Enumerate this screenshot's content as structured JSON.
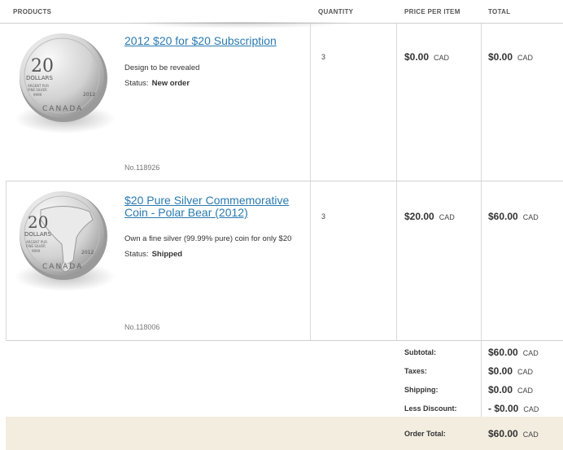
{
  "columns": {
    "products": "PRODUCTS",
    "quantity": "QUANTITY",
    "price": "PRICE PER ITEM",
    "total": "TOTAL"
  },
  "items": [
    {
      "title": "2012 $20 for $20 Subscription",
      "description": "Design to be revealed",
      "status_label": "Status:",
      "status": "New order",
      "sku": "No.118926",
      "quantity": "3",
      "price": "$0.00",
      "price_currency": "CAD",
      "total": "$0.00",
      "total_currency": "CAD",
      "coin": {
        "denomination": "20",
        "unit": "DOLLARS",
        "metal_line1": "ARGENT PUR",
        "metal_line2": "FINE SILVER",
        "purity": "9999",
        "year": "2012",
        "country": "CANADA"
      }
    },
    {
      "title": "$20 Pure Silver Commemorative Coin - Polar Bear (2012)",
      "description": "Own a fine silver (99.99% pure) coin for only $20",
      "status_label": "Status:",
      "status": "Shipped",
      "sku": "No.118006",
      "quantity": "3",
      "price": "$20.00",
      "price_currency": "CAD",
      "total": "$60.00",
      "total_currency": "CAD",
      "coin": {
        "denomination": "20",
        "unit": "DOLLARS",
        "metal_line1": "ARGENT PUR",
        "metal_line2": "FINE SILVER",
        "purity": "9999",
        "year": "2012",
        "country": "CANADA"
      }
    }
  ],
  "totals": {
    "subtotal_label": "Subtotal:",
    "subtotal": "$60.00",
    "subtotal_currency": "CAD",
    "taxes_label": "Taxes:",
    "taxes": "$0.00",
    "taxes_currency": "CAD",
    "shipping_label": "Shipping:",
    "shipping": "$0.00",
    "shipping_currency": "CAD",
    "discount_label": "Less Discount:",
    "discount": "- $0.00",
    "discount_currency": "CAD",
    "order_total_label": "Order Total:",
    "order_total": "$60.00",
    "order_total_currency": "CAD"
  },
  "colors": {
    "link": "#2a7ab0",
    "total_bar": "#f3ede0",
    "border": "#d0d0d0"
  }
}
